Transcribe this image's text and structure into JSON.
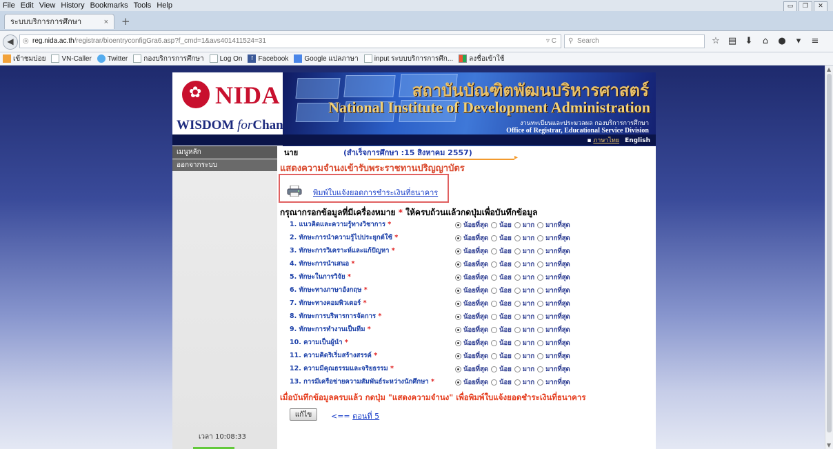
{
  "browser": {
    "menu": [
      "File",
      "Edit",
      "View",
      "History",
      "Bookmarks",
      "Tools",
      "Help"
    ],
    "tab_title": "ระบบบริการการศึกษา",
    "url_host": "reg.nida.ac.th",
    "url_path": "/registrar/bioentryconfigGra6.asp?f_cmd=1&avs401411524=31",
    "search_placeholder": "Search",
    "bookmarks": [
      "เข้าชมบ่อย",
      "VN-Caller",
      "Twitter",
      "กองบริการการศึกษา",
      "Log On",
      "Facebook",
      "Google แปลภาษา",
      "input ระบบบริการการศึก...",
      "ลงชื่อเข้าใช้"
    ]
  },
  "banner": {
    "logo_text": "NIDA",
    "slogan_main": "WISDOM",
    "slogan_for": "for",
    "slogan_change": "Change",
    "thai_name": "สถาบันบัณฑิตพัฒนบริหารศาสตร์",
    "eng_name": "National Institute of Development Administration",
    "office_th": "งานทะเบียนและประมวลผล กองบริการการศึกษา",
    "office_en": "Office of Registrar, Educational Service Division",
    "lang_th": "ภาษาไทย",
    "lang_en": "English"
  },
  "sidebar": {
    "main_menu": "เมนูหลัก",
    "logout": "ออกจากระบบ",
    "time": "เวลา 10:08:33"
  },
  "main": {
    "title_prefix": "นาย",
    "graduation": "(สำเร็จการศึกษา :15 สิงหาคม 2557)",
    "section_title": "แสดงความจำนงเข้ารับพระราชทานปริญญาบัตร",
    "print_link": "พิมพ์ใบแจ้งยอดการชำระเงินที่ธนาคาร",
    "instruction": "กรุณากรอกข้อมูลที่มีเครื่องหมาย",
    "instruction_star": "*",
    "instruction_rest": "ให้ครบถ้วนแล้วกดปุ่มเพื่อบันทึกข้อมูล",
    "options": [
      "น้อยที่สุด",
      "น้อย",
      "มาก",
      "มากที่สุด"
    ],
    "questions": [
      "1. แนวคิดและความรู้ทางวิชาการ",
      "2. ทักษะการนำความรู้ไปประยุกต์ใช้",
      "3. ทักษะการวิเคราะห์และแก้ปัญหา",
      "4. ทักษะการนำเสนอ",
      "5. ทักษะในการวิจัย",
      "6. ทักษะทางภาษาอังกฤษ",
      "7. ทักษะทางคอมพิวเตอร์",
      "8. ทักษะการบริหารการจัดการ",
      "9. ทักษะการทำงานเป็นทีม",
      "10. ความเป็นผู้นำ",
      "11. ความคิดริเริ่มสร้างสรรค์",
      "12. ความมีคุณธรรมและจริยธรรม",
      "13. การมีเครือข่ายความสัมพันธ์ระหว่างนักศึกษา"
    ],
    "selected_option_index": 0,
    "after_note": "เมื่อบันทึกข้อมูลครบแล้ว กดปุ่ม \"แสดงความจำนง\" เพื่อพิมพ์ใบแจ้งยอดชำระเงินที่ธนาคาร",
    "edit_button": "แก้ไข",
    "back_arrow": "<==",
    "back_label": "ตอนที่ 5"
  },
  "colors": {
    "banner_navy": "#1c2a7e",
    "nida_red": "#c8102e",
    "section_red": "#d9472b",
    "link_blue": "#1a3fc9"
  }
}
